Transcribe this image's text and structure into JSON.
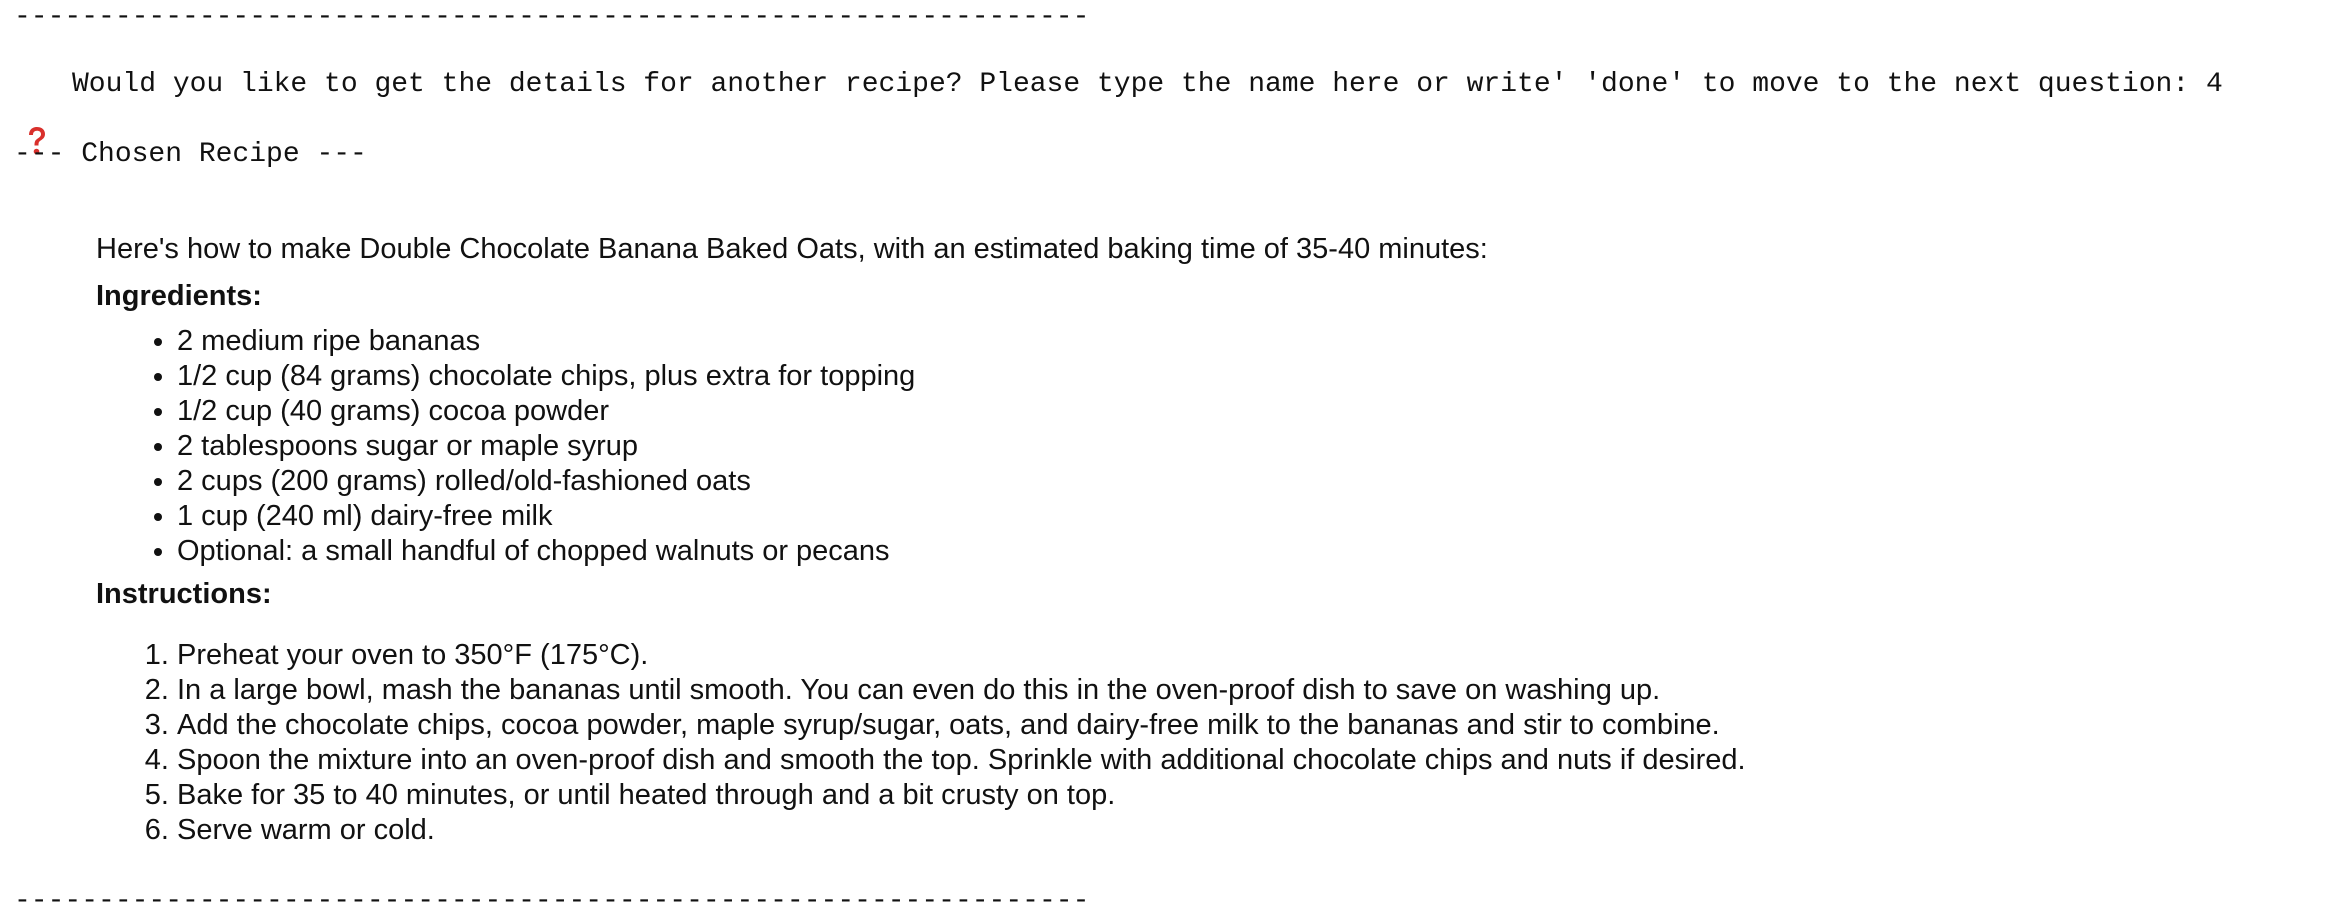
{
  "separators": {
    "top": "----------------------------------------------------------------",
    "bottom": "----------------------------------------------------------------"
  },
  "prompt": {
    "icon": "red-question-mark-icon",
    "icon_color": "#d9302c",
    "text": "Would you like to get the details for another recipe? Please type the name here or write' 'done' to move to the next question: 4"
  },
  "chosen_header": "--- Chosen Recipe ---",
  "recipe": {
    "intro": "Here's how to make Double Chocolate Banana Baked Oats, with an estimated baking time of 35-40 minutes:",
    "ingredients_title": "Ingredients:",
    "ingredients": [
      "2 medium ripe bananas",
      "1/2 cup (84 grams) chocolate chips, plus extra for topping",
      "1/2 cup (40 grams) cocoa powder",
      "2 tablespoons sugar or maple syrup",
      "2 cups (200 grams) rolled/old-fashioned oats",
      "1 cup (240 ml) dairy-free milk",
      "Optional: a small handful of chopped walnuts or pecans"
    ],
    "instructions_title": "Instructions:",
    "instructions": [
      "Preheat your oven to 350°F (175°C).",
      "In a large bowl, mash the bananas until smooth. You can even do this in the oven-proof dish to save on washing up.",
      "Add the chocolate chips, cocoa powder, maple syrup/sugar, oats, and dairy-free milk to the bananas and stir to combine.",
      "Spoon the mixture into an oven-proof dish and smooth the top. Sprinkle with additional chocolate chips and nuts if desired.",
      "Bake for 35 to 40 minutes, or until heated through and a bit crusty on top.",
      "Serve warm or cold."
    ]
  }
}
